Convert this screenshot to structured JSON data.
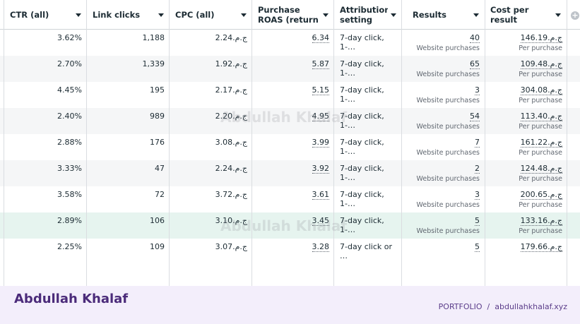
{
  "columns": [
    {
      "label": "CTR (all)"
    },
    {
      "label": "Link clicks"
    },
    {
      "label": "CPC (all)"
    },
    {
      "label": "Purchase ROAS (return on ad…"
    },
    {
      "label": "Attribution setting"
    },
    {
      "label": "Results"
    },
    {
      "label": "Cost per result"
    }
  ],
  "rows": [
    {
      "ctr": "3.62%",
      "clicks": "1,188",
      "cpc": "ج.م.2.24",
      "roas": "6.34",
      "attr": "7-day click, 1-…",
      "results": "40",
      "results_sub": "Website purchases",
      "cost": "ج.م.146.19",
      "cost_sub": "Per purchase"
    },
    {
      "ctr": "2.70%",
      "clicks": "1,339",
      "cpc": "ج.م.1.92",
      "roas": "5.87",
      "attr": "7-day click, 1-…",
      "results": "65",
      "results_sub": "Website purchases",
      "cost": "ج.م.109.48",
      "cost_sub": "Per purchase"
    },
    {
      "ctr": "4.45%",
      "clicks": "195",
      "cpc": "ج.م.2.17",
      "roas": "5.15",
      "attr": "7-day click, 1-…",
      "results": "3",
      "results_sub": "Website purchases",
      "cost": "ج.م.304.08",
      "cost_sub": "Per purchase"
    },
    {
      "ctr": "2.40%",
      "clicks": "989",
      "cpc": "ج.م.2.20",
      "roas": "4.95",
      "attr": "7-day click, 1-…",
      "results": "54",
      "results_sub": "Website purchases",
      "cost": "ج.م.113.40",
      "cost_sub": "Per purchase"
    },
    {
      "ctr": "2.88%",
      "clicks": "176",
      "cpc": "ج.م.3.08",
      "roas": "3.99",
      "attr": "7-day click, 1-…",
      "results": "7",
      "results_sub": "Website purchases",
      "cost": "ج.م.161.22",
      "cost_sub": "Per purchase"
    },
    {
      "ctr": "3.33%",
      "clicks": "47",
      "cpc": "ج.م.2.24",
      "roas": "3.92",
      "attr": "7-day click, 1-…",
      "results": "2",
      "results_sub": "Website purchases",
      "cost": "ج.م.124.48",
      "cost_sub": "Per purchase"
    },
    {
      "ctr": "3.58%",
      "clicks": "72",
      "cpc": "ج.م.3.72",
      "roas": "3.61",
      "attr": "7-day click, 1-…",
      "results": "3",
      "results_sub": "Website purchases",
      "cost": "ج.م.200.65",
      "cost_sub": "Per purchase"
    },
    {
      "ctr": "2.89%",
      "clicks": "106",
      "cpc": "ج.م.3.10",
      "roas": "3.45",
      "attr": "7-day click, 1-…",
      "results": "5",
      "results_sub": "Website purchases",
      "cost": "ج.م.133.16",
      "cost_sub": "Per purchase"
    },
    {
      "ctr": "2.25%",
      "clicks": "109",
      "cpc": "ج.م.3.07",
      "roas": "3.28",
      "attr": "7-day click or …",
      "results": "5",
      "results_sub": "",
      "cost": "ج.م.179.66",
      "cost_sub": ""
    }
  ],
  "watermark": "Abdullah Khalaf",
  "footer": {
    "brand": "Abdullah Khalaf",
    "portfolio_label": "PORTFOLIO",
    "separator": "/",
    "site": "abdullahkhalaf.xyz"
  },
  "icons": {
    "add_column": "plus-circle-icon",
    "sort": "caret-down-icon"
  },
  "colors": {
    "highlight_row": "#e6f4ef",
    "alt_row": "#f5f6f7",
    "footer_bg": "#f3eefb",
    "brand": "#4b2b7a"
  }
}
